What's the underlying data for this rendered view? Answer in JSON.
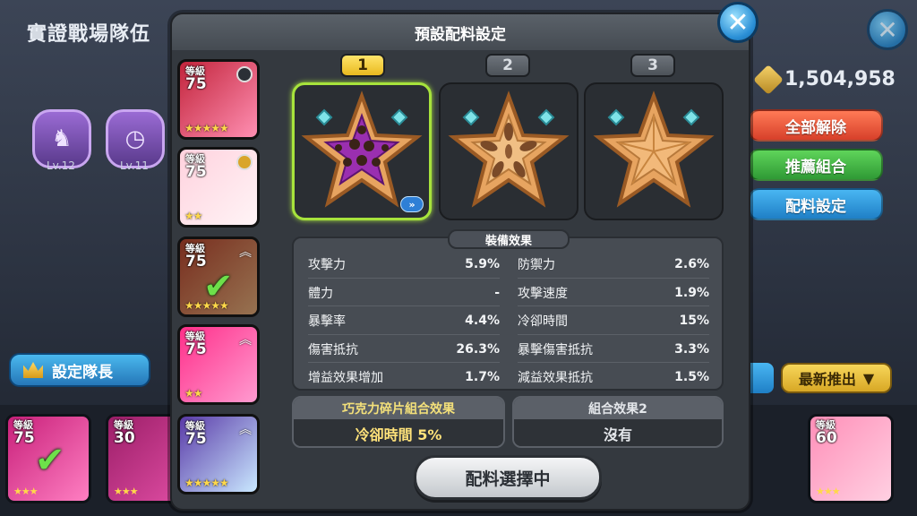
{
  "background": {
    "title": "實證戰場隊伍",
    "badges": [
      {
        "level": "Lv.12",
        "icon": "unicorn-badge-icon"
      },
      {
        "level": "Lv.11",
        "icon": "clock-badge-icon"
      }
    ],
    "coins": "1,504,958",
    "buttons": {
      "release_all": "全部解除",
      "recommend": "推薦組合",
      "topping_setting": "配料設定",
      "set_leader": "設定隊長",
      "sort": "最新推出"
    },
    "bottom_cards": [
      {
        "level_label": "等級",
        "level": "75",
        "stars": "★★★",
        "checked": true
      },
      {
        "level_label": "等級",
        "level": "30",
        "stars": "★★★"
      },
      {
        "level_label": "等級",
        "level": "60",
        "stars": "★★★"
      }
    ]
  },
  "modal": {
    "title": "預設配料設定",
    "cookies": [
      {
        "level_label": "等級",
        "level": "75",
        "stars": "★★★★★",
        "colors": [
          "#c2243b",
          "#ff8fb2"
        ]
      },
      {
        "level_label": "等級",
        "level": "75",
        "stars": "★★",
        "colors": [
          "#ffd2de",
          "#fff4f6"
        ]
      },
      {
        "level_label": "等級",
        "level": "75",
        "stars": "★★★★★",
        "colors": [
          "#b8462f",
          "#e8b07c"
        ],
        "checked": true
      },
      {
        "level_label": "等級",
        "level": "75",
        "stars": "★★",
        "colors": [
          "#ff2f8a",
          "#ff9bd0"
        ]
      },
      {
        "level_label": "等級",
        "level": "75",
        "stars": "★★★★★",
        "colors": [
          "#5a3aa8",
          "#c9e8ff"
        ]
      }
    ],
    "tabs": [
      "1",
      "2",
      "3"
    ],
    "active_tab": "1",
    "effects_label": "裝備效果",
    "stats_left": [
      {
        "name": "攻擊力",
        "value": "5.9%"
      },
      {
        "name": "體力",
        "value": "-"
      },
      {
        "name": "暴擊率",
        "value": "4.4%"
      },
      {
        "name": "傷害抵抗",
        "value": "26.3%"
      },
      {
        "name": "增益效果增加",
        "value": "1.7%"
      }
    ],
    "stats_right": [
      {
        "name": "防禦力",
        "value": "2.6%"
      },
      {
        "name": "攻擊速度",
        "value": "1.9%"
      },
      {
        "name": "冷卻時間",
        "value": "15%"
      },
      {
        "name": "暴擊傷害抵抗",
        "value": "3.3%"
      },
      {
        "name": "減益效果抵抗",
        "value": "1.5%"
      }
    ],
    "combo1": {
      "title": "巧克力碎片組合效果",
      "value": "冷卻時間 5%"
    },
    "combo2": {
      "title": "組合效果2",
      "value": "沒有"
    },
    "main_button": "配料選擇中"
  }
}
